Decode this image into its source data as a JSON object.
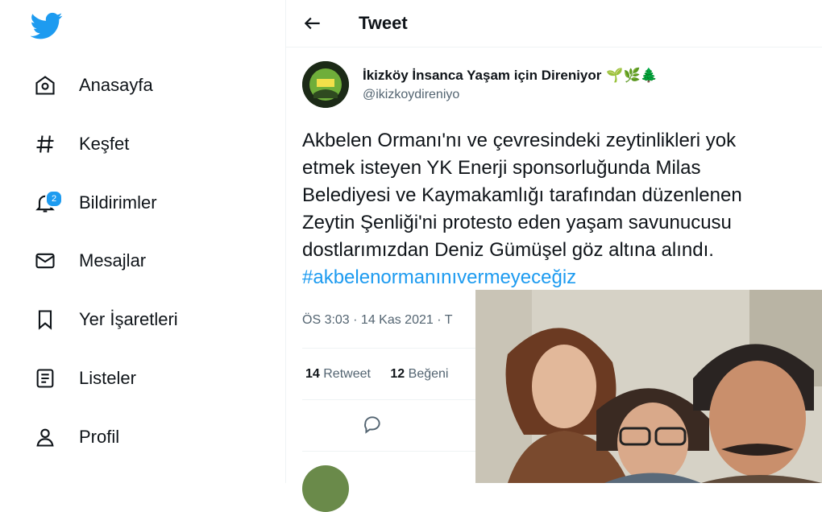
{
  "sidebar": {
    "logo": "twitter-bird-icon",
    "items": [
      {
        "label": "Anasayfa",
        "icon": "home-icon"
      },
      {
        "label": "Keşfet",
        "icon": "hashtag-icon"
      },
      {
        "label": "Bildirimler",
        "icon": "bell-icon",
        "badge": "2"
      },
      {
        "label": "Mesajlar",
        "icon": "envelope-icon"
      },
      {
        "label": "Yer İşaretleri",
        "icon": "bookmark-icon"
      },
      {
        "label": "Listeler",
        "icon": "list-icon"
      },
      {
        "label": "Profil",
        "icon": "person-icon"
      }
    ]
  },
  "header": {
    "title": "Tweet",
    "back_icon": "arrow-left-icon"
  },
  "tweet": {
    "author_name": "İkizköy İnsanca Yaşam için Direniyor",
    "author_emoji": "🌱🌿🌲",
    "handle": "@ikizkoydireniyo",
    "text_lines": [
      "Akbelen Ormanı'nı ve çevresindeki zeytinlikleri yok",
      "etmek isteyen YK Enerji sponsorluğunda Milas",
      "Belediyesi ve Kaymakamlığı tarafından düzenlenen",
      "Zeytin Şenliği'ni protesto eden yaşam savunucusu",
      "dostlarımızdan Deniz Gümüşel göz altına alındı."
    ],
    "hashtag": "#akbelenormanınıvermeyeceğiz",
    "meta": "ÖS 3:03 · 14 Kas 2021 · T",
    "retweets": "14",
    "retweets_label": "Retweet",
    "likes": "12",
    "likes_label": "Beğeni"
  },
  "colors": {
    "accent": "#1d9bf0",
    "text": "#0f1419",
    "secondary": "#536471",
    "border": "#eff3f4"
  }
}
